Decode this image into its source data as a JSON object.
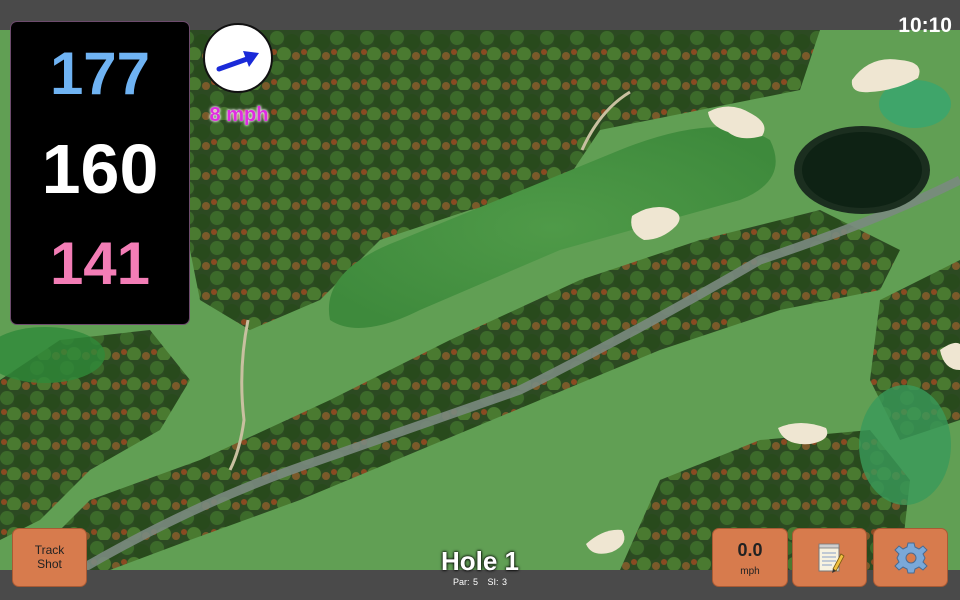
{
  "status": {
    "clock": "10:10"
  },
  "distances": {
    "back": "177",
    "middle": "160",
    "front": "141"
  },
  "wind": {
    "speed": "8 mph",
    "icon": "wind-direction-arrow-icon"
  },
  "hole": {
    "title": "Hole 1",
    "par": "Par: 5",
    "si": "SI: 3"
  },
  "buttons": {
    "track_shot": {
      "line1": "Track",
      "line2": "Shot"
    },
    "speed": {
      "value": "0.0",
      "unit": "mph"
    },
    "notes_icon": "notepad-icon",
    "settings_icon": "gear-icon"
  },
  "colors": {
    "back_distance": "#6fb3f3",
    "middle_distance": "#ffffff",
    "front_distance": "#f37db6",
    "wind_text": "#e02de0",
    "button": "#d77b4d"
  }
}
